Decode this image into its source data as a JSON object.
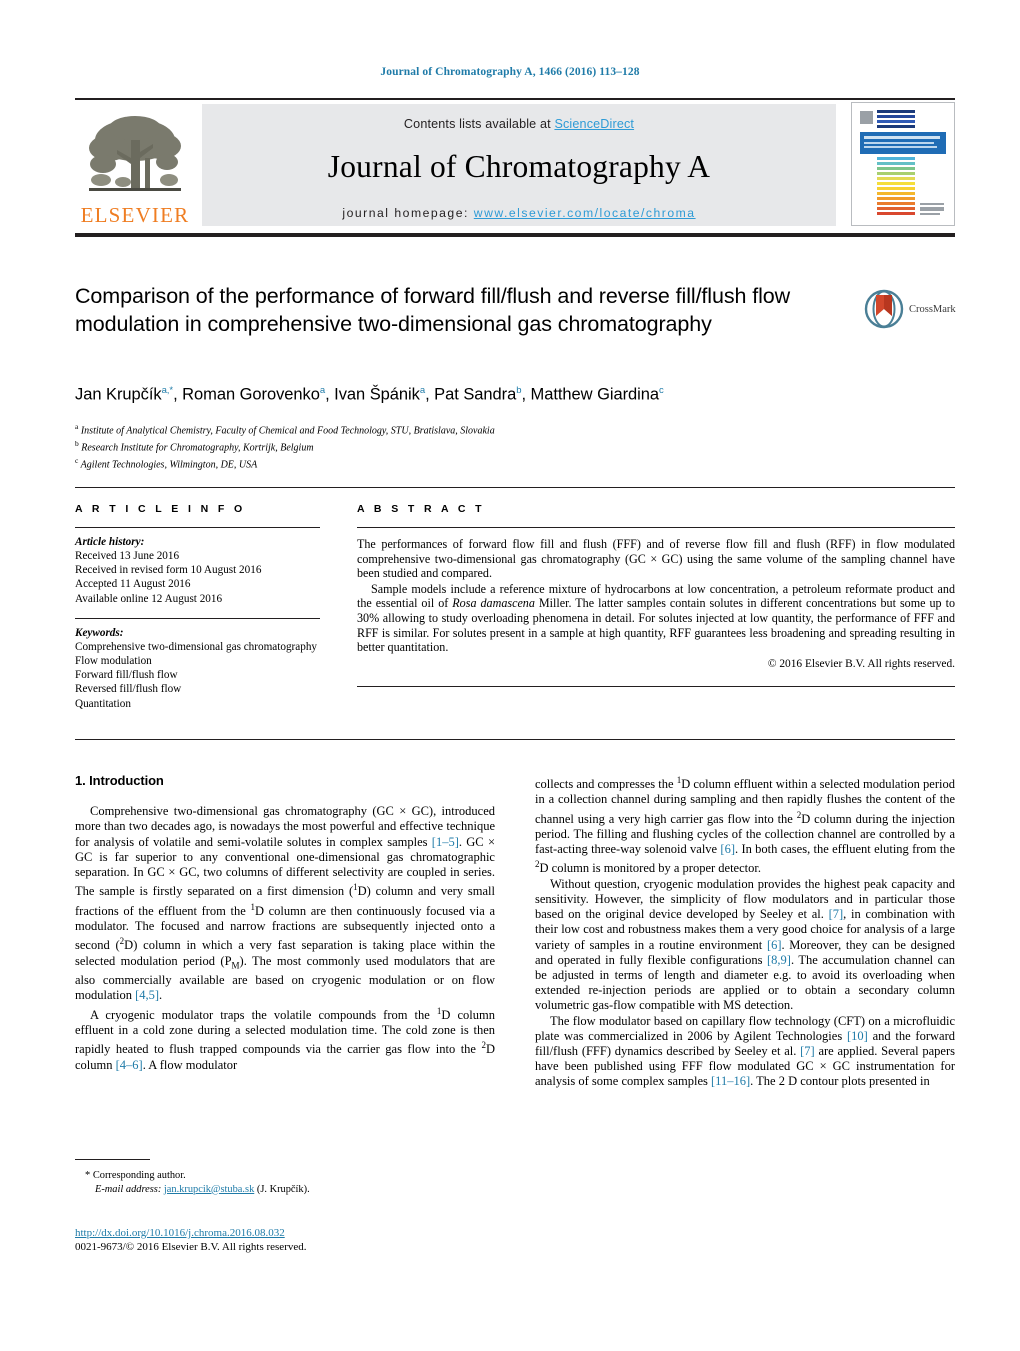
{
  "running_head": "Journal of Chromatography A, 1466 (2016) 113–128",
  "masthead": {
    "contents_prefix": "Contents lists available at ",
    "sciencedirect": "ScienceDirect",
    "journal_title": "Journal of Chromatography A",
    "homepage_prefix": "journal homepage: ",
    "homepage_url": "www.elsevier.com/locate/chroma",
    "publisher": "ELSEVIER",
    "logo_icon": "elsevier-tree-icon",
    "cover_icon": "journal-cover-thumbnail",
    "accent_blue": "#2e9bd6",
    "publisher_orange": "#ef7d22",
    "box_gray": "#e7e8ea"
  },
  "article": {
    "title": "Comparison of the performance of forward fill/flush and reverse fill/flush flow modulation in comprehensive two-dimensional gas chromatography",
    "crossmark_label": "CrossMark",
    "crossmark_icon": "crossmark-logo-icon",
    "authors_html": "Jan Krupčík<sup>a,*</sup>, Roman Gorovenko<sup>a</sup>, Ivan Špánik<sup>a</sup>, Pat Sandra<sup>b</sup>, Matthew Giardina<sup>c</sup>",
    "affiliations": [
      {
        "marker": "a",
        "text": "Institute of Analytical Chemistry, Faculty of Chemical and Food Technology, STU, Bratislava, Slovakia"
      },
      {
        "marker": "b",
        "text": "Research Institute for Chromatography, Kortrijk, Belgium"
      },
      {
        "marker": "c",
        "text": "Agilent Technologies, Wilmington, DE, USA"
      }
    ]
  },
  "article_info": {
    "heading": "A R T I C L E    I N F O",
    "history_label": "Article history:",
    "history": [
      "Received 13 June 2016",
      "Received in revised form 10 August 2016",
      "Accepted 11 August 2016",
      "Available online 12 August 2016"
    ],
    "keywords_label": "Keywords:",
    "keywords": [
      "Comprehensive two-dimensional gas chromatography",
      "Flow modulation",
      "Forward fill/flush flow",
      "Reversed fill/flush flow",
      "Quantitation"
    ]
  },
  "abstract": {
    "heading": "A B S T R A C T",
    "paragraph_1": "The performances of forward flow fill and flush (FFF) and of reverse flow fill and flush (RFF) in flow modulated comprehensive two-dimensional gas chromatography (GC × GC) using the same volume of the sampling channel have been studied and compared.",
    "paragraph_2": "Sample models include a reference mixture of hydrocarbons at low concentration, a petroleum reformate product and the essential oil of Rosa damascena Miller. The latter samples contain solutes in different concentrations but some up to 30% allowing to study overloading phenomena in detail. For solutes injected at low quantity, the performance of FFF and RFF is similar. For solutes present in a sample at high quantity, RFF guarantees less broadening and spreading resulting in better quantitation.",
    "rights": "© 2016 Elsevier B.V. All rights reserved."
  },
  "body": {
    "section_heading": "1.  Introduction",
    "left_paragraphs": [
      "Comprehensive two-dimensional gas chromatography (GC × GC), introduced more than two decades ago, is nowadays the most powerful and effective technique for analysis of volatile and semi-volatile solutes in complex samples [1–5]. GC × GC is far superior to any conventional one-dimensional gas chromatographic separation. In GC × GC, two columns of different selectivity are coupled in series. The sample is firstly separated on a first dimension (1D) column and very small fractions of the effluent from the 1D column are then continuously focused via a modulator. The focused and narrow fractions are subsequently injected onto a second (2D) column in which a very fast separation is taking place within the selected modulation period (PM). The most commonly used modulators that are also commercially available are based on cryogenic modulation or on flow modulation [4,5].",
      "A cryogenic modulator traps the volatile compounds from the 1D column effluent in a cold zone during a selected modulation time. The cold zone is then rapidly heated to flush trapped compounds via the carrier gas flow into the 2D column [4–6]. A flow modulator"
    ],
    "right_paragraphs": [
      "collects and compresses the 1D column effluent within a selected modulation period in a collection channel during sampling and then rapidly flushes the content of the channel using a very high carrier gas flow into the 2D column during the injection period. The filling and flushing cycles of the collection channel are controlled by a fast-acting three-way solenoid valve [6]. In both cases, the effluent eluting from the 2D column is monitored by a proper detector.",
      "Without question, cryogenic modulation provides the highest peak capacity and sensitivity. However, the simplicity of flow modulators and in particular those based on the original device developed by Seeley et al. [7], in combination with their low cost and robustness makes them a very good choice for analysis of a large variety of samples in a routine environment [6]. Moreover, they can be designed and operated in fully flexible configurations [8,9]. The accumulation channel can be adjusted in terms of length and diameter e.g. to avoid its overloading when extended re-injection periods are applied or to obtain a secondary column volumetric gas-flow compatible with MS detection.",
      "The flow modulator based on capillary flow technology (CFT) on a microfluidic plate was commercialized in 2006 by Agilent Technologies [10] and the forward fill/flush (FFF) dynamics described by Seeley et al. [7] are applied. Several papers have been published using FFF flow modulated GC × GC instrumentation for analysis of some complex samples [11–16]. The 2 D contour plots presented in"
    ]
  },
  "footnote": {
    "star_marker": "*",
    "corresponding": "Corresponding author.",
    "email_label": "E-mail address:",
    "email": "jan.krupcik@stuba.sk",
    "email_suffix": "(J. Krupčík).",
    "doi": "http://dx.doi.org/10.1016/j.chroma.2016.08.032",
    "issn_line": "0021-9673/© 2016 Elsevier B.V. All rights reserved."
  }
}
